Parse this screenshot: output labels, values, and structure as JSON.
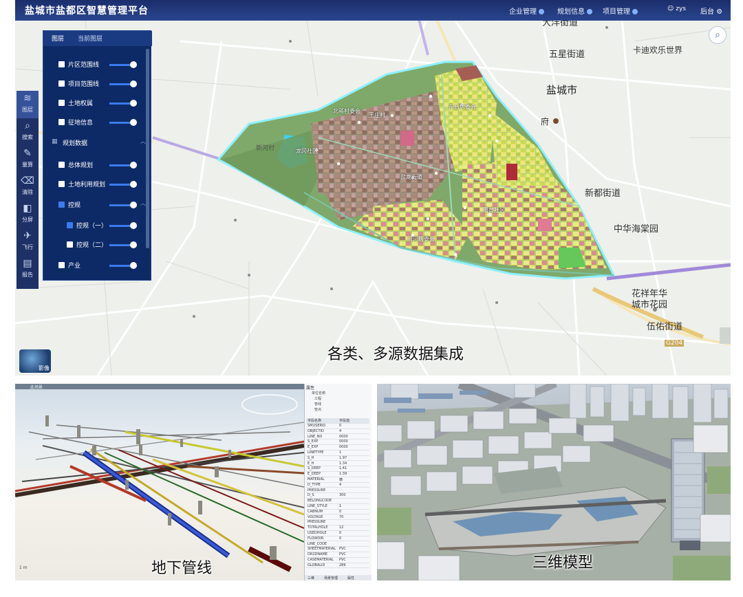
{
  "app": {
    "title": "盐城市盐都区智慧管理平台",
    "nav": [
      "企业管理",
      "规划信息",
      "项目管理"
    ],
    "user": "zys",
    "admin_label": "后台"
  },
  "layer_panel": {
    "tabs": [
      "图层",
      "当前图层"
    ],
    "rows": [
      {
        "label": "片区范围线",
        "checked": false,
        "indent": 0,
        "slider": true
      },
      {
        "label": "项目范围线",
        "checked": false,
        "indent": 0,
        "slider": true
      },
      {
        "label": "土地权属",
        "checked": false,
        "indent": 0,
        "slider": true
      },
      {
        "label": "征地信息",
        "checked": false,
        "indent": 0,
        "slider": true
      },
      {
        "label": "规划数据",
        "checked": false,
        "indent": 0,
        "slider": false,
        "group": true
      },
      {
        "label": "总体规划",
        "checked": false,
        "indent": 0,
        "slider": true
      },
      {
        "label": "土地利用规划",
        "checked": false,
        "indent": 0,
        "slider": true
      },
      {
        "label": "控规",
        "checked": true,
        "indent": 0,
        "slider": true
      },
      {
        "label": "控规（一）",
        "checked": true,
        "indent": 1,
        "slider": true
      },
      {
        "label": "控规（二）",
        "checked": false,
        "indent": 1,
        "slider": true
      },
      {
        "label": "产业",
        "checked": false,
        "indent": 0,
        "slider": true
      }
    ]
  },
  "toolbar": [
    "图层",
    "搜索",
    "量算",
    "清除",
    "分屏",
    "飞行",
    "报告"
  ],
  "globe_label": "影像",
  "map_labels": {
    "city": "盐城市",
    "wuxing": "五星街道",
    "xindu": "新都街道",
    "zhonghua": "中华海棠园",
    "huaxiang": "花祥年华\n城市花园",
    "wuyou": "伍佑街道",
    "dayang": "大洋街道",
    "kada": "卡迪欢乐世界",
    "fu": "府",
    "villages": [
      "北蒋村委会",
      "龙冈社区",
      "盐龙街道",
      "潘黄社区",
      "沿河居委会",
      "东台居委会",
      "新河村",
      "王庄村"
    ],
    "road": "G204"
  },
  "captions": {
    "map": "各类、多源数据集成",
    "pipe": "地下管线",
    "model": "三维模型"
  },
  "pipe_viewer": {
    "tab": "此场景",
    "properties_title": "属性",
    "tree": [
      "单位名称",
      "工程",
      "管线",
      "管点"
    ],
    "table_header": [
      "字段名称",
      "字段值"
    ],
    "fields": [
      [
        "SMUSERID",
        "0"
      ],
      [
        "OBJECTID",
        "4"
      ],
      [
        "LINE_NO",
        "0000"
      ],
      [
        "S_EXP",
        "0000"
      ],
      [
        "E_EXP",
        "0000"
      ],
      [
        "LINETYPE",
        "1"
      ],
      [
        "S_H",
        "1.97"
      ],
      [
        "E_H",
        "1.34"
      ],
      [
        "S_DEEP",
        "1.41"
      ],
      [
        "E_DEEP",
        "1.39"
      ],
      [
        "MATERIAL",
        "铸"
      ],
      [
        "D_TYPE",
        "4"
      ],
      [
        "PRESSURE",
        ""
      ],
      [
        "D_S",
        "300"
      ],
      [
        "BELONGCODE",
        ""
      ],
      [
        "LINE_STYLE",
        "1"
      ],
      [
        "CABNUM",
        "0"
      ],
      [
        "VOLTAGE",
        "70"
      ],
      [
        "PRESSURE",
        ""
      ],
      [
        "TOTALHOLE",
        "12"
      ],
      [
        "USEDHOLE",
        "0"
      ],
      [
        "FLOWDIR",
        "0"
      ],
      [
        "LINE_CODE",
        ""
      ],
      [
        "SHEETMATERIAL",
        "PVC"
      ],
      [
        "DR2DNAME",
        "PVC"
      ],
      [
        "CASEMATERIAL",
        "PVC"
      ],
      [
        "GLOBALID",
        "289"
      ]
    ],
    "bottom_tabs": [
      "三维",
      "场景管理",
      "属性"
    ]
  }
}
